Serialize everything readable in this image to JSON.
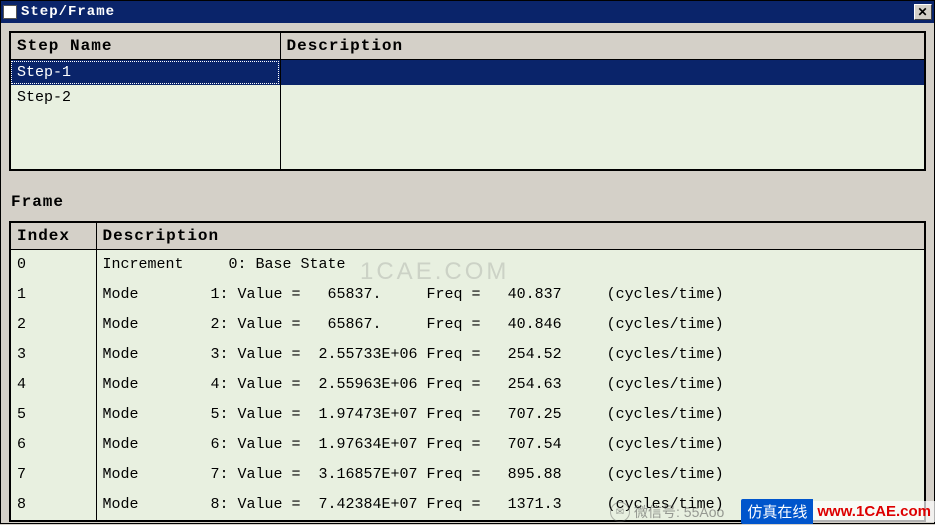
{
  "window": {
    "title": "Step/Frame"
  },
  "step_table": {
    "headers": {
      "name": "Step Name",
      "desc": "Description"
    },
    "rows": [
      {
        "name": "Step-1",
        "desc": "",
        "selected": true
      },
      {
        "name": "Step-2",
        "desc": "",
        "selected": false
      }
    ]
  },
  "frame_section_label": "Frame",
  "frame_table": {
    "headers": {
      "index": "Index",
      "desc": "Description"
    },
    "rows": [
      {
        "index": "0",
        "desc": "Increment     0: Base State"
      },
      {
        "index": "1",
        "desc": "Mode        1: Value =   65837.     Freq =   40.837     (cycles/time)"
      },
      {
        "index": "2",
        "desc": "Mode        2: Value =   65867.     Freq =   40.846     (cycles/time)"
      },
      {
        "index": "3",
        "desc": "Mode        3: Value =  2.55733E+06 Freq =   254.52     (cycles/time)"
      },
      {
        "index": "4",
        "desc": "Mode        4: Value =  2.55963E+06 Freq =   254.63     (cycles/time)"
      },
      {
        "index": "5",
        "desc": "Mode        5: Value =  1.97473E+07 Freq =   707.25     (cycles/time)"
      },
      {
        "index": "6",
        "desc": "Mode        6: Value =  1.97634E+07 Freq =   707.54     (cycles/time)"
      },
      {
        "index": "7",
        "desc": "Mode        7: Value =  3.16857E+07 Freq =   895.88     (cycles/time)"
      },
      {
        "index": "8",
        "desc": "Mode        8: Value =  7.42384E+07 Freq =   1371.3     (cycles/time)"
      }
    ]
  },
  "overlays": {
    "center_watermark": "1CAE.COM",
    "wechat_text": "微信号: 55Aoo",
    "brand_cn": "仿真在线",
    "brand_url": "www.1CAE.com"
  }
}
